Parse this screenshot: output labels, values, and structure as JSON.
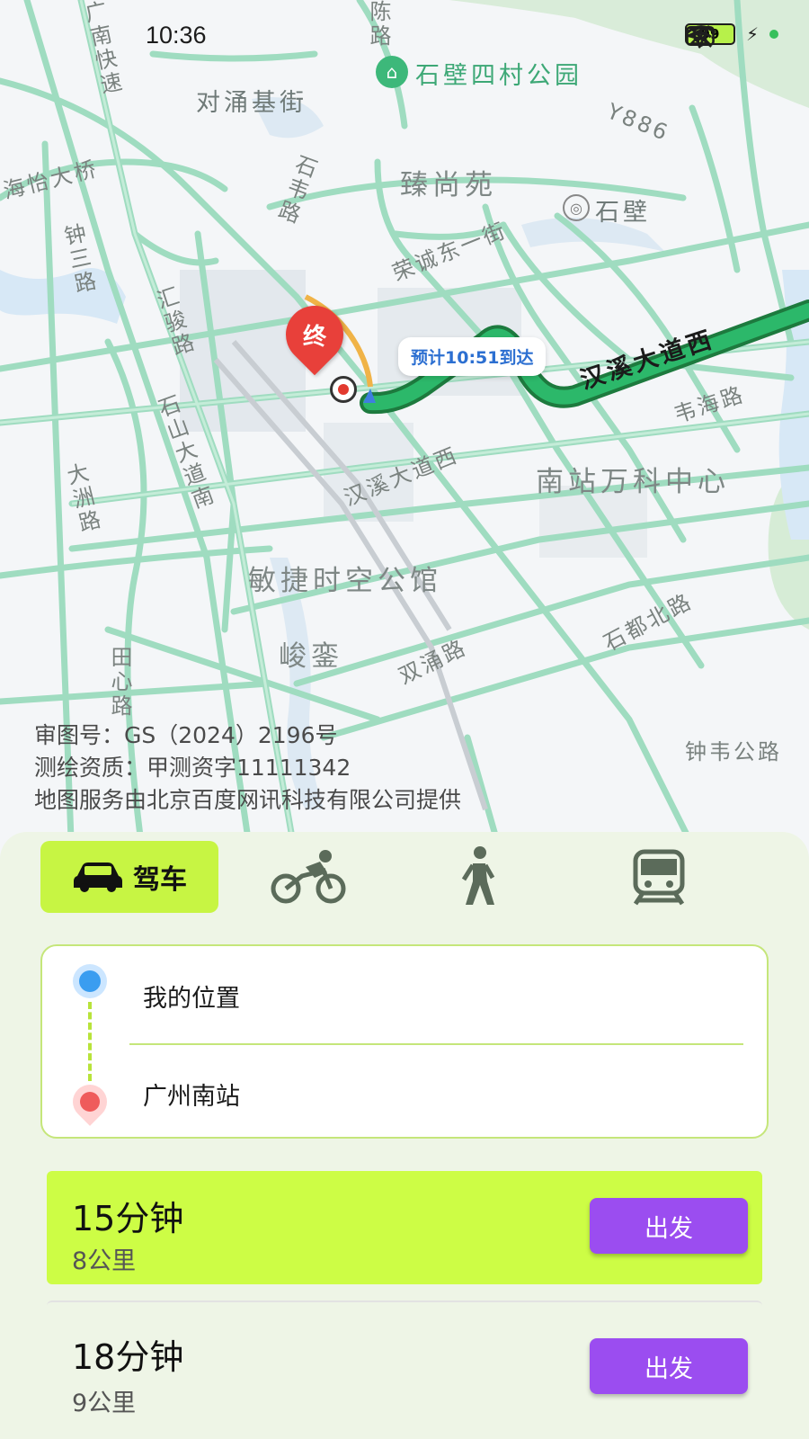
{
  "status_bar": {
    "time": "10:36",
    "battery": "99"
  },
  "map": {
    "labels": {
      "park": "石壁四村公园",
      "duiyong": "对涌基街",
      "haiyi": "海怡大桥",
      "zhenshang": "臻尚苑",
      "shibi": "石壁",
      "y886": "Y886",
      "rongcheng": "荣诚东一街",
      "shiwei": "石韦路",
      "huijun": "汇骏路",
      "zhongsan": "钟三路",
      "shishan": "石山大道南",
      "dazhou": "大洲路",
      "hanxi_east": "汉溪大道西",
      "hanxi_mid": "汉溪大道西",
      "weihai": "韦海路",
      "nanzhan_vanke": "南站万科中心",
      "minjie": "敏捷时空公馆",
      "junluan": "峻銮",
      "shuangyong": "双涌路",
      "shidu_north": "石都北路",
      "tianxin": "田心路",
      "zhongwei": "钟韦公路",
      "guangnan": "广南快速",
      "chen": "陈路"
    },
    "eta_bubble": "预计10:51到达",
    "end_marker": "终",
    "credits": {
      "line1": "审图号：GS（2024）2196号",
      "line2": "测绘资质：甲测资字11111342",
      "line3": "地图服务由北京百度网讯科技有限公司提供"
    }
  },
  "modes": {
    "drive_label": "驾车"
  },
  "route_input": {
    "origin": "我的位置",
    "destination": "广州南站"
  },
  "routes": [
    {
      "time": "15分钟",
      "distance": "8公里",
      "go_label": "出发"
    },
    {
      "time": "18分钟",
      "distance": "9公里",
      "go_label": "出发"
    }
  ]
}
